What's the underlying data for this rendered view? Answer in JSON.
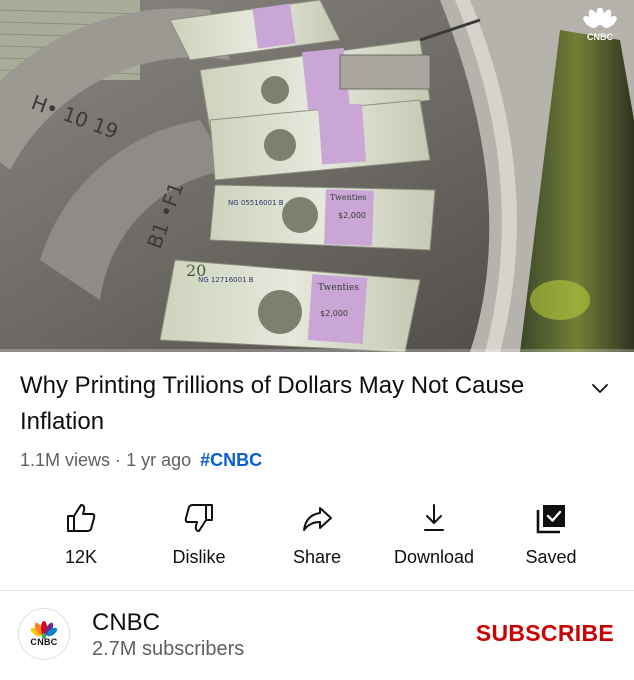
{
  "video": {
    "watermark": "CNBC",
    "progress_fraction": 0.0,
    "bill_texts": {
      "serial_1": "NG 05516001 B",
      "serial_2": "NG 12716001 B",
      "band_label": "Twenties",
      "band_amount": "$2,000",
      "number": "20"
    }
  },
  "title": "Why Printing Trillions of Dollars May Not Cause Inflation",
  "meta": {
    "views": "1.1M views",
    "separator": "·",
    "age": "1 yr ago",
    "hashtag": "#CNBC"
  },
  "actions": [
    {
      "label": "12K",
      "icon": "thumbs-up-icon"
    },
    {
      "label": "Dislike",
      "icon": "thumbs-down-icon"
    },
    {
      "label": "Share",
      "icon": "share-icon"
    },
    {
      "label": "Download",
      "icon": "download-icon"
    },
    {
      "label": "Saved",
      "icon": "saved-icon"
    }
  ],
  "channel": {
    "name": "CNBC",
    "subscribers": "2.7M subscribers",
    "avatar_text": "CNBC",
    "subscribe_label": "SUBSCRIBE"
  },
  "colors": {
    "subscribe": "#cc0000",
    "hashtag": "#065fd4",
    "meta": "#606060",
    "bill_band": "#c9a6d6"
  }
}
